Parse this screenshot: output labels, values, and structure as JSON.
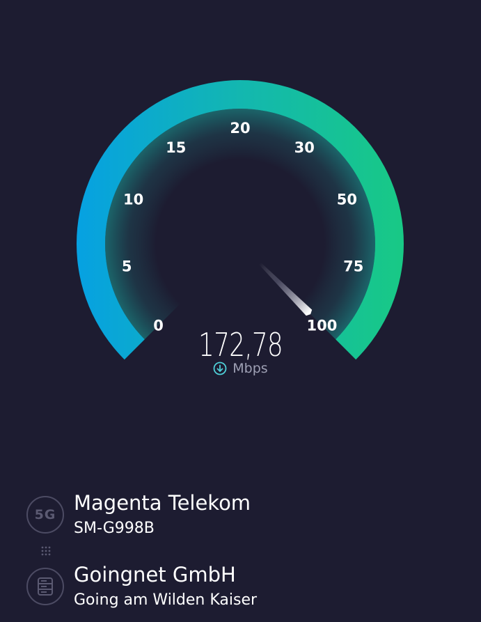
{
  "speed_gauge": {
    "ticks": [
      "0",
      "5",
      "10",
      "15",
      "20",
      "30",
      "50",
      "75",
      "100"
    ],
    "needle_value": "100",
    "value": "172,78",
    "unit": "Mbps",
    "direction_icon": "download-arrow-icon",
    "colors": {
      "background": "#1d1c31",
      "arc_start": "#06a1e2",
      "arc_mid": "#13b7b0",
      "arc_end": "#18c985",
      "needle": "#ffffff"
    }
  },
  "connection": {
    "provider_badge": "5G",
    "provider_name": "Magenta Telekom",
    "device_model": "SM-G998B",
    "server_icon": "server-icon",
    "server_name": "Goingnet GmbH",
    "server_location": "Going am Wilden Kaiser"
  }
}
